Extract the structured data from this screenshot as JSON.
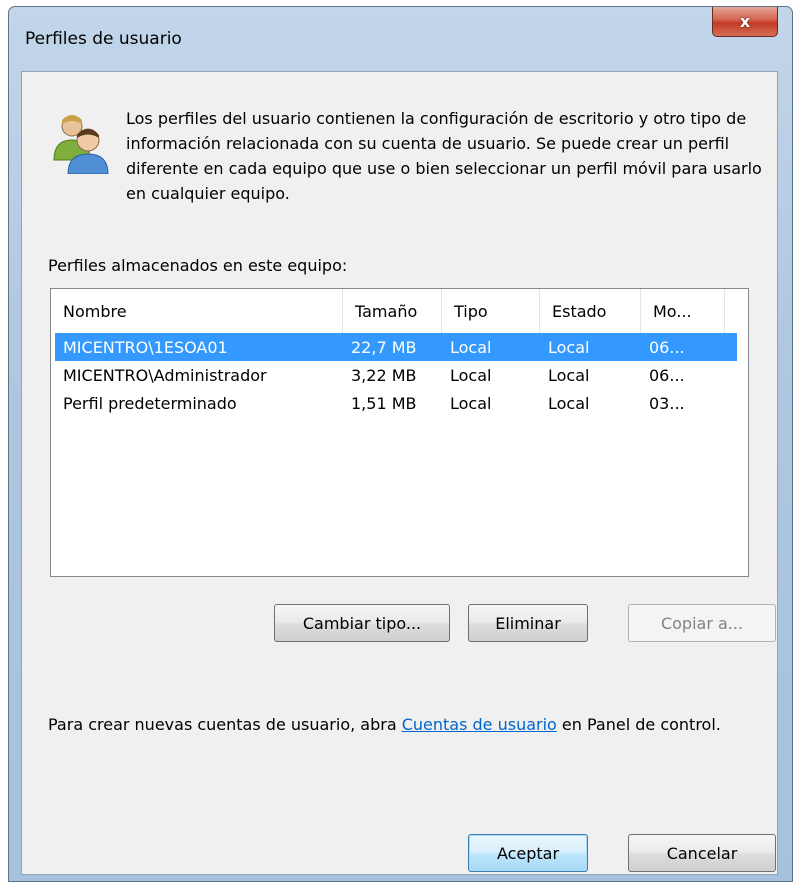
{
  "window": {
    "title": "Perfiles de usuario",
    "close_glyph": "x"
  },
  "intro": {
    "icon": "users-icon",
    "text": "Los perfiles del usuario contienen la configuración de escritorio y otro tipo de información relacionada con su cuenta de usuario. Se puede crear un perfil diferente en cada equipo que use o bien seleccionar un perfil móvil para usarlo en cualquier equipo."
  },
  "profiles": {
    "label": "Perfiles almacenados en este equipo:",
    "columns": [
      "Nombre",
      "Tamaño",
      "Tipo",
      "Estado",
      "Mo..."
    ],
    "rows": [
      {
        "name": "MICENTRO\\1ESOA01",
        "size": "22,7 MB",
        "type": "Local",
        "status": "Local",
        "modified": "06...",
        "selected": true
      },
      {
        "name": "MICENTRO\\Administrador",
        "size": "3,22 MB",
        "type": "Local",
        "status": "Local",
        "modified": "06...",
        "selected": false
      },
      {
        "name": "Perfil predeterminado",
        "size": "1,51 MB",
        "type": "Local",
        "status": "Local",
        "modified": "03...",
        "selected": false
      }
    ]
  },
  "actions": {
    "change_type": "Cambiar tipo...",
    "delete": "Eliminar",
    "copy_to": "Copiar a..."
  },
  "footer": {
    "text_before": "Para crear nuevas cuentas de usuario, abra ",
    "link": "Cuentas de usuario",
    "text_after": " en Panel de control."
  },
  "dialog_buttons": {
    "ok": "Aceptar",
    "cancel": "Cancelar"
  },
  "colors": {
    "selection": "#3399ff",
    "link": "#0066cc"
  }
}
